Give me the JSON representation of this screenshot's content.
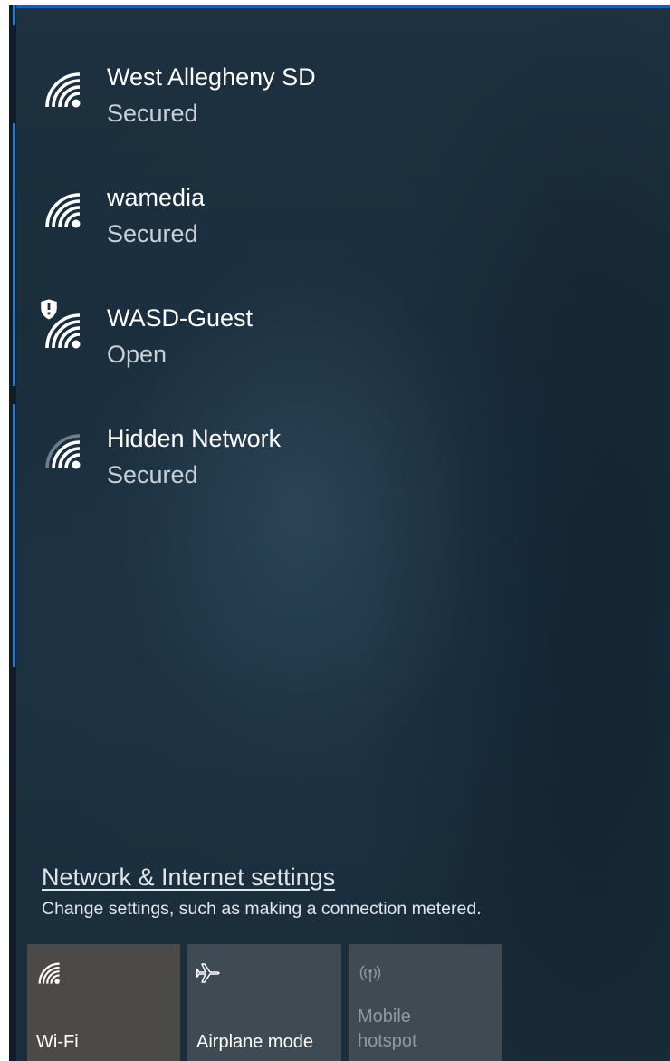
{
  "networks": [
    {
      "name": "West Allegheny SD",
      "status": "Secured",
      "icon": "wifi-strong-icon"
    },
    {
      "name": "wamedia",
      "status": "Secured",
      "icon": "wifi-strong-icon"
    },
    {
      "name": "WASD-Guest",
      "status": "Open",
      "icon": "wifi-open-warning-icon"
    },
    {
      "name": "Hidden Network",
      "status": "Secured",
      "icon": "wifi-weak-icon"
    }
  ],
  "settings": {
    "link_label": "Network & Internet settings",
    "description": "Change settings, such as making a connection metered."
  },
  "quick_actions": [
    {
      "label": "Wi-Fi",
      "icon": "wifi-icon",
      "state": "on"
    },
    {
      "label": "Airplane mode",
      "icon": "airplane-icon",
      "state": "off"
    },
    {
      "label_line1": "Mobile",
      "label_line2": "hotspot",
      "icon": "mobile-hotspot-icon",
      "state": "disabled"
    }
  ],
  "colors": {
    "panel_background": "#1b2e3c",
    "accent": "#2b78d8",
    "wifi_tile_active": "#4b4a47",
    "tile_inactive": "#404a53"
  }
}
